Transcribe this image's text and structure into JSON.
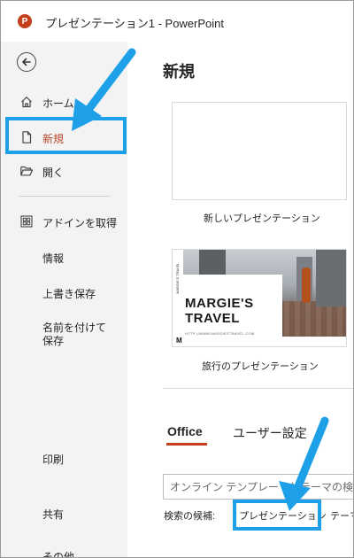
{
  "window": {
    "title": "プレゼンテーション1 - PowerPoint",
    "app_logo_letter": "P",
    "brand_color": "#c43e1c"
  },
  "sidebar": {
    "back_icon": "back-arrow-icon",
    "items": [
      {
        "label": "ホーム",
        "icon": "home-icon"
      },
      {
        "label": "新規",
        "icon": "new-file-icon",
        "active": true
      },
      {
        "label": "開く",
        "icon": "folder-open-icon"
      },
      {
        "label": "アドインを取得",
        "icon": "grid-icon"
      },
      {
        "label": "情報"
      },
      {
        "label": "上書き保存"
      },
      {
        "label": "名前を付けて保存"
      },
      {
        "label": "印刷"
      },
      {
        "label": "共有"
      },
      {
        "label": "その他..."
      }
    ]
  },
  "main": {
    "title": "新規",
    "templates": [
      {
        "label": "新しいプレゼンテーション"
      },
      {
        "label": "旅行のプレゼンテーション",
        "thumb_title": "MARGIE'S\nTRAVEL",
        "thumb_url": "HTTP://WWW.MARGIESTRAVEL.COM",
        "thumb_side": "MARGIE'S TRAVEL",
        "thumb_mark": "M"
      }
    ],
    "tabs": [
      {
        "label": "Office",
        "active": true
      },
      {
        "label": "ユーザー設定"
      }
    ],
    "search": {
      "placeholder": "オンライン テンプレートとテーマの検索"
    },
    "suggestions": {
      "label": "検索の候補:",
      "items": [
        "プレゼンテーション",
        "テーマ"
      ]
    }
  },
  "annotations": {
    "highlight_color": "#1ea0e8"
  }
}
